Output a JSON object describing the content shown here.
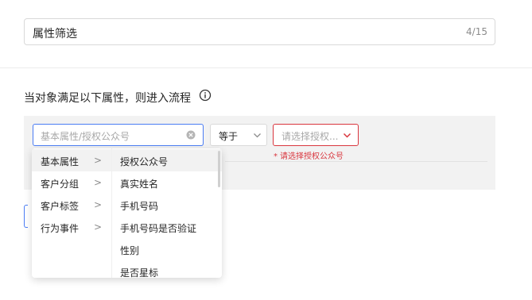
{
  "name_field": {
    "value": "属性筛选",
    "counter": "4/15"
  },
  "condition": {
    "title": "当对象满足以下属性，则进入流程",
    "attribute_placeholder": "基本属性/授权公众号",
    "operator_value": "等于",
    "value_placeholder": "请选择授权...",
    "error_message": "请选择授权公众号",
    "error_marker": "*"
  },
  "cascader": {
    "categories": [
      {
        "label": "基本属性",
        "arrow": ">"
      },
      {
        "label": "客户分组",
        "arrow": ">"
      },
      {
        "label": "客户标签",
        "arrow": ">"
      },
      {
        "label": "行为事件",
        "arrow": ">"
      }
    ],
    "options": [
      {
        "label": "授权公众号"
      },
      {
        "label": "真实姓名"
      },
      {
        "label": "手机号码"
      },
      {
        "label": "手机号码是否验证"
      },
      {
        "label": "性别"
      },
      {
        "label": "是否星标"
      }
    ]
  },
  "colors": {
    "accent": "#4a7cf4",
    "error": "#d9363e",
    "panel_bg": "#f2f2f2"
  }
}
